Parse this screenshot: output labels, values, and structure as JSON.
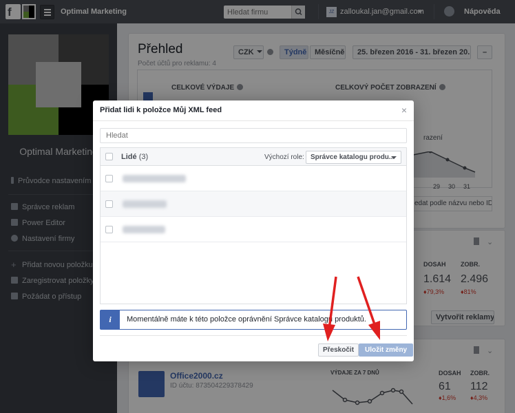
{
  "topbar": {
    "logo_letter": "f",
    "business_name": "Optimal Marketing",
    "search_placeholder": "Hledat firmu",
    "avatar_initials": "JZ",
    "user_email": "zalloukal.jan@gmail.com",
    "help_label": "Nápověda"
  },
  "sidebar": {
    "business_title": "Optimal Marketing",
    "guide": "Průvodce nastavením",
    "items": [
      "Správce reklam",
      "Power Editor",
      "Nastavení firmy"
    ],
    "actions": [
      "Přidat novou položku",
      "Zaregistrovat položky",
      "Požádat o přístup"
    ]
  },
  "overview": {
    "title": "Přehled",
    "subtitle": "Počet účtů pro reklamu: 4",
    "currency": "CZK",
    "tab_weekly": "Týdně",
    "tab_monthly": "Měsíčně",
    "date_range": "25. březen 2016 - 31. březen 20...",
    "collapse": "–",
    "total_spend_label": "CELKOVÉ VÝDAJE",
    "total_impressions_label": "CELKOVÝ POČET ZOBRAZENÍ",
    "impressions_partial": "razení",
    "chart_days": [
      "29",
      "30",
      "31"
    ],
    "search_placeholder": "edat podle názvu nebo ID"
  },
  "account1": {
    "reach_label": "DOSAH",
    "impr_label": "ZOBR.",
    "reach": "1.614",
    "impr": "2.496",
    "reach_change": "♦79,3%",
    "impr_change": "♦81%",
    "create_ads": "Vytvořit reklamy"
  },
  "account2": {
    "name": "Office2000.cz",
    "id_text": "ID účtu: 873504229378429",
    "spend7": "VÝDAJE ZA 7 DNŮ",
    "reach_label": "DOSAH",
    "impr_label": "ZOBR.",
    "reach": "61",
    "impr": "112",
    "reach_change": "♦1,6%",
    "impr_change": "♦4,3%"
  },
  "dialog": {
    "title": "Přidat lidi k položce Můj XML feed",
    "close": "×",
    "search_placeholder": "Hledat",
    "people_label": "Lidé",
    "people_count": "(3)",
    "default_role_label": "Výchozí role:",
    "default_role_value": "Správce katalogu produ...",
    "info_icon": "i",
    "info_text": "Momentálně máte k této položce oprávnění Správce katalogu produktů.",
    "skip_label": "Přeskočit",
    "save_label": "Uložit změny"
  },
  "colors": {
    "topbar": "#4b4f56",
    "sidebar": "#3b3e45",
    "accent": "#4267b2",
    "arrow": "#e02020",
    "negative": "#d33a2c"
  }
}
